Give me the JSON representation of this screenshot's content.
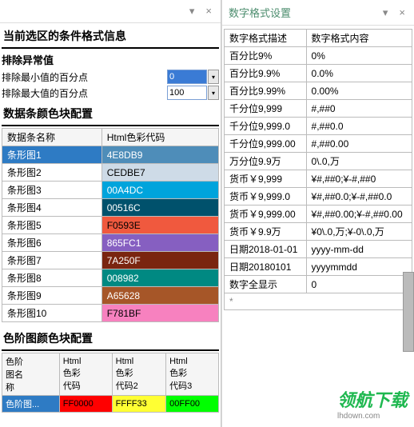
{
  "left": {
    "title_cut": "",
    "dropdown_icon": "▾",
    "close_icon": "×",
    "h1": "当前选区的条件格式信息",
    "h2": "排除异常值",
    "row_min": "排除最小值的百分点",
    "row_max": "排除最大值的百分点",
    "val_min": "0",
    "val_max": "100",
    "h3": "数据条颜色块配置",
    "bar_cols": [
      "数据条名称",
      "Html色彩代码"
    ],
    "bars": [
      {
        "name": "条形图1",
        "code": "4E8DB9",
        "hex": "#4E8DB9",
        "fg": "#fff",
        "sel": true
      },
      {
        "name": "条形图2",
        "code": "CEDBE7",
        "hex": "#CEDBE7",
        "fg": "#000"
      },
      {
        "name": "条形图3",
        "code": "00A4DC",
        "hex": "#00A4DC",
        "fg": "#fff"
      },
      {
        "name": "条形图4",
        "code": "00516C",
        "hex": "#00516C",
        "fg": "#fff"
      },
      {
        "name": "条形图5",
        "code": "F0593E",
        "hex": "#F0593E",
        "fg": "#000"
      },
      {
        "name": "条形图6",
        "code": "865FC1",
        "hex": "#865FC1",
        "fg": "#fff"
      },
      {
        "name": "条形图7",
        "code": "7A250F",
        "hex": "#7A250F",
        "fg": "#fff"
      },
      {
        "name": "条形图8",
        "code": "008982",
        "hex": "#008982",
        "fg": "#fff"
      },
      {
        "name": "条形图9",
        "code": "A65628",
        "hex": "#A65628",
        "fg": "#fff"
      },
      {
        "name": "条形图10",
        "code": "F781BF",
        "hex": "#F781BF",
        "fg": "#000"
      }
    ],
    "h4": "色阶图颜色块配置",
    "grad_cols": [
      "色阶\n图名\n称",
      "Html\n色彩\n代码",
      "Html\n色彩\n代码2",
      "Html\n色彩\n代码3"
    ],
    "grad_row": {
      "name": "色阶图...",
      "c1": "FF0000",
      "c2": "FFFF33",
      "c3": "00FF00"
    }
  },
  "right": {
    "title": "数字格式设置",
    "cols": [
      "数字格式描述",
      "数字格式内容"
    ],
    "rows": [
      [
        "百分比9%",
        "0%"
      ],
      [
        "百分比9.9%",
        "0.0%"
      ],
      [
        "百分比9.99%",
        "0.00%"
      ],
      [
        "千分位9,999",
        "#,##0"
      ],
      [
        "千分位9,999.0",
        "#,##0.0"
      ],
      [
        "千分位9,999.00",
        "#,##0.00"
      ],
      [
        "万分位9.9万",
        "0\\.0,万"
      ],
      [
        "货币￥9,999",
        "¥#,##0;¥-#,##0"
      ],
      [
        "货币￥9,999.0",
        "¥#,##0.0;¥-#,##0.0"
      ],
      [
        "货币￥9,999.00",
        "¥#,##0.00;¥-#,##0.00"
      ],
      [
        "货币￥9.9万",
        "¥0\\.0,万;¥-0\\.0,万"
      ],
      [
        "日期2018-01-01",
        "yyyy-mm-dd"
      ],
      [
        "日期20180101",
        "yyyymmdd"
      ],
      [
        "数字全显示",
        "0"
      ]
    ]
  },
  "watermark": {
    "main": "领航下载",
    "sub": "lhdown.com"
  }
}
